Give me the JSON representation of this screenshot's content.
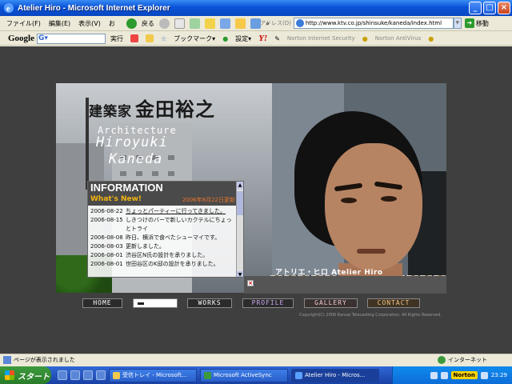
{
  "window": {
    "title": "Atelier Hiro - Microsoft Internet Explorer",
    "buttons": {
      "minimize": "_",
      "maximize": "□",
      "close": "×"
    }
  },
  "menu": [
    "ファイル(F)",
    "編集(E)",
    "表示(V)",
    "お"
  ],
  "toolbar": {
    "back_label": "戻る",
    "more1": "»",
    "address_label": "アドレス(D)",
    "address_value": "http://www.ktv.co.jp/shinsuke/kaneda/index.html",
    "go_label": "移動"
  },
  "google_bar": {
    "logo": "Google",
    "search_label": "実行",
    "bookmark_label": "ブックマーク▾",
    "settings_label": "設定▾",
    "yahoo": "Y!",
    "norton_security": "Norton Internet Security",
    "norton_antivirus": "Norton AntiVirus"
  },
  "hero": {
    "kanji_prefix": "建築家",
    "kanji_name": "金田裕之",
    "architecture": "Architecture",
    "name_first": "Hiroyuki",
    "name_last": "Kaneda",
    "signature": "アトリエ・ヒロ Atelier Hiro"
  },
  "info": {
    "heading": "INFORMATION",
    "whats_new": "What's New!",
    "updated": "2006年8月22日更新",
    "items": [
      {
        "date": "2006-08-22",
        "text": "ちょっとパーティーに行ってきました。",
        "link": true
      },
      {
        "date": "2006-08-15",
        "text": "しきつけのバーで新しいカクテルにちょっとトライ",
        "link": false
      },
      {
        "date": "2006-08-08",
        "text": "昨日、横浜で食べたシューマイです。",
        "link": false
      },
      {
        "date": "2006-08-03",
        "text": "更新しました。",
        "link": false
      },
      {
        "date": "2006-08-01",
        "text": "渋谷区N氏の設計を承りました。",
        "link": false
      },
      {
        "date": "2006-08-01",
        "text": "世田谷区のK邸の設計を承りました。",
        "link": false
      }
    ]
  },
  "nav": {
    "home": "HOME",
    "works": "WORKS",
    "profile": "PROFILE",
    "gallery": "GALLERY",
    "contact": "CONTACT"
  },
  "copyright": "Copyright(C) 2006 Kansai Telecasting Corporation. All Rights Reserved.",
  "statusbar": {
    "status": "ページが表示されました",
    "zone": "インターネット"
  },
  "taskbar": {
    "start": "スタート",
    "tasks": [
      "受信トレイ - Microsoft...",
      "Microsoft ActiveSync",
      "Atelier Hiro - Micros..."
    ],
    "norton": "Norton",
    "clock": "23:29"
  },
  "colors": {
    "page_bg": "#3f3f3f",
    "whats_new": "#f2b511",
    "updated": "#e8742a",
    "profile": "#c8a8f0",
    "gallery": "#f0c8c8",
    "contact": "#f4c484"
  }
}
